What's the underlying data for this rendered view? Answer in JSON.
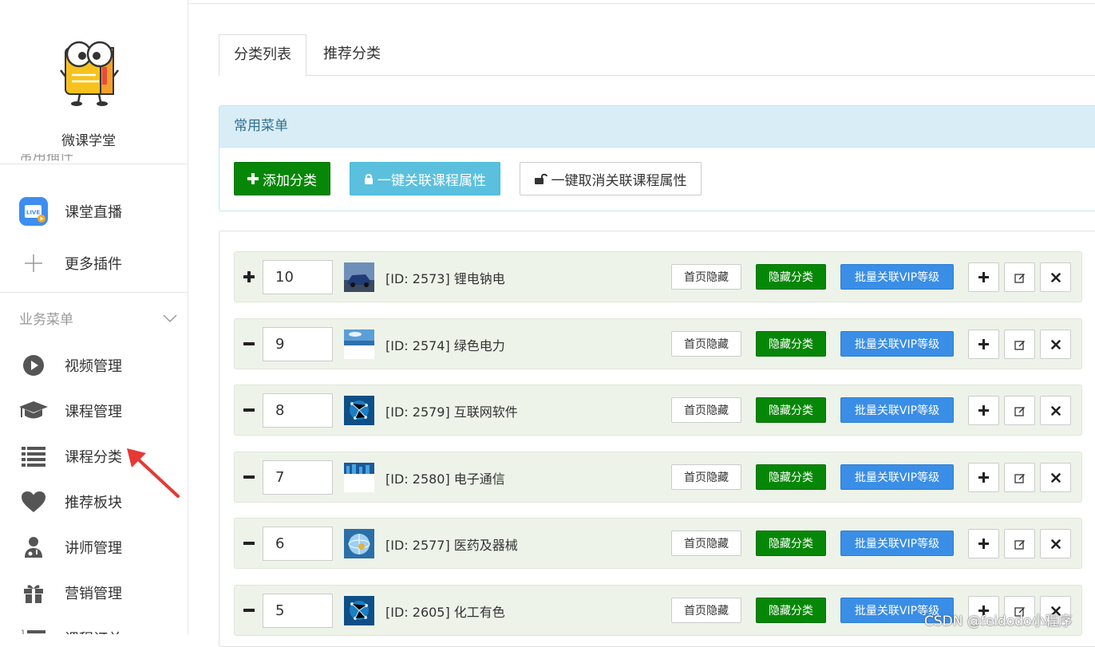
{
  "sidebar": {
    "brand": "微课学堂",
    "partial_section_label": "常用插件",
    "plugins": [
      {
        "label": "课堂直播",
        "icon": "live-icon"
      },
      {
        "label": "更多插件",
        "icon": "plus-icon"
      }
    ],
    "business_section": {
      "title": "业务菜单",
      "icon": "chevron-down-icon"
    },
    "business_items": [
      {
        "label": "视频管理",
        "icon": "play-circle-icon"
      },
      {
        "label": "课程管理",
        "icon": "graduation-cap-icon"
      },
      {
        "label": "课程分类",
        "icon": "list-icon"
      },
      {
        "label": "推荐板块",
        "icon": "heart-icon"
      },
      {
        "label": "讲师管理",
        "icon": "user-md-icon"
      },
      {
        "label": "营销管理",
        "icon": "gift-icon"
      },
      {
        "label": "课程订单",
        "icon": "ordered-list-icon"
      }
    ]
  },
  "tabs": [
    {
      "label": "分类列表",
      "active": true
    },
    {
      "label": "推荐分类",
      "active": false
    }
  ],
  "common_menu": {
    "title": "常用菜单",
    "add_label": "添加分类",
    "link_label": "一键关联课程属性",
    "unlink_label": "一键取消关联课程属性"
  },
  "row_actions": {
    "home_hide": "首页隐藏",
    "hide_category": "隐藏分类",
    "vip_link": "批量关联VIP等级"
  },
  "categories": [
    {
      "sort": "10",
      "name": "[ID: 2573] 锂电钠电",
      "toggle": "+",
      "thumb": "car"
    },
    {
      "sort": "9",
      "name": "[ID: 2574] 绿色电力",
      "toggle": "−",
      "thumb": "sky"
    },
    {
      "sort": "8",
      "name": "[ID: 2579] 互联网软件",
      "toggle": "−",
      "thumb": "network"
    },
    {
      "sort": "7",
      "name": "[ID: 2580] 电子通信",
      "toggle": "−",
      "thumb": "city"
    },
    {
      "sort": "6",
      "name": "[ID: 2577] 医药及器械",
      "toggle": "−",
      "thumb": "globe"
    },
    {
      "sort": "5",
      "name": "[ID: 2605] 化工有色",
      "toggle": "−",
      "thumb": "network"
    }
  ],
  "watermark": "CSDN @feidodo小程序",
  "colors": {
    "primary_green": "#078707",
    "info_blue": "#5bc0de",
    "vip_blue": "#3a8ee6",
    "panel_head_bg": "#d9edf7",
    "row_bg": "#eef3e9",
    "arrow_red": "#e53935"
  }
}
